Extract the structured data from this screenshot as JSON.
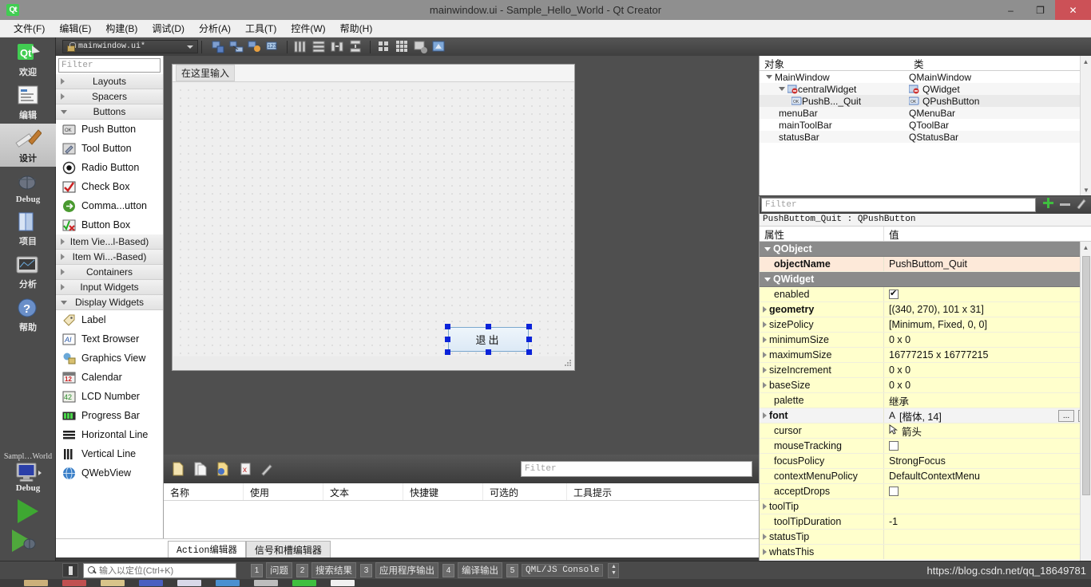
{
  "titlebar": {
    "title": "mainwindow.ui - Sample_Hello_World - Qt Creator",
    "app_icon": "qt-logo-icon",
    "minimize": "–",
    "restore": "❐",
    "close": "✕"
  },
  "menubar": {
    "items": [
      {
        "label": "文件(F)"
      },
      {
        "label": "编辑(E)"
      },
      {
        "label": "构建(B)"
      },
      {
        "label": "调试(D)"
      },
      {
        "label": "分析(A)"
      },
      {
        "label": "工具(T)"
      },
      {
        "label": "控件(W)"
      },
      {
        "label": "帮助(H)"
      }
    ]
  },
  "designer_toolbar": {
    "file_combo": {
      "value": "mainwindow.ui*",
      "icon": "lock-icon",
      "dropdown": "chevron-down-icon"
    },
    "tools": [
      {
        "name": "edit-widgets-icon"
      },
      {
        "name": "edit-signals-slots-icon"
      },
      {
        "name": "edit-buddies-icon"
      },
      {
        "name": "edit-tab-order-icon"
      },
      {
        "name": "layout-horizontally-icon"
      },
      {
        "name": "layout-vertically-icon"
      },
      {
        "name": "layout-splitter-horizontal-icon"
      },
      {
        "name": "layout-splitter-vertical-icon"
      },
      {
        "name": "layout-form-icon"
      },
      {
        "name": "layout-grid-icon"
      },
      {
        "name": "break-layout-icon"
      },
      {
        "name": "adjust-size-icon"
      }
    ]
  },
  "modebar": {
    "modes": [
      {
        "label": "欢迎",
        "icon": "qt-welcome-icon",
        "active": false
      },
      {
        "label": "编辑",
        "icon": "edit-mode-icon",
        "active": false
      },
      {
        "label": "设计",
        "icon": "design-mode-icon",
        "active": true
      },
      {
        "label": "Debug",
        "icon": "debug-bug-icon",
        "active": false
      },
      {
        "label": "项目",
        "icon": "projects-books-icon",
        "active": false
      },
      {
        "label": "分析",
        "icon": "analyze-scope-icon",
        "active": false
      },
      {
        "label": "帮助",
        "icon": "help-question-icon",
        "active": false
      }
    ],
    "run_section": {
      "project_label": "Sampl…World",
      "kit_icon": "computer-kit-icon",
      "kit_label": "Debug",
      "run_button": "run-icon",
      "debug_button": "start-debugging-icon",
      "build_button": "build-hammer-icon"
    }
  },
  "widget_box": {
    "filter_placeholder": "Filter",
    "groups": [
      {
        "label": "Layouts",
        "expanded": false,
        "items": []
      },
      {
        "label": "Spacers",
        "expanded": false,
        "items": []
      },
      {
        "label": "Buttons",
        "expanded": true,
        "items": [
          {
            "label": "Push Button",
            "icon": "push-button-icon"
          },
          {
            "label": "Tool Button",
            "icon": "tool-button-icon"
          },
          {
            "label": "Radio Button",
            "icon": "radio-button-icon"
          },
          {
            "label": "Check Box",
            "icon": "check-box-icon"
          },
          {
            "label": "Comma...utton",
            "icon": "command-link-button-icon"
          },
          {
            "label": "Button Box",
            "icon": "button-box-icon"
          }
        ]
      },
      {
        "label": "Item Vie...l-Based)",
        "expanded": false,
        "items": []
      },
      {
        "label": "Item Wi...-Based)",
        "expanded": false,
        "items": []
      },
      {
        "label": "Containers",
        "expanded": false,
        "items": []
      },
      {
        "label": "Input Widgets",
        "expanded": false,
        "items": []
      },
      {
        "label": "Display Widgets",
        "expanded": true,
        "items": [
          {
            "label": "Label",
            "icon": "label-icon"
          },
          {
            "label": "Text Browser",
            "icon": "text-browser-icon"
          },
          {
            "label": "Graphics View",
            "icon": "graphics-view-icon"
          },
          {
            "label": "Calendar",
            "icon": "calendar-icon"
          },
          {
            "label": "LCD Number",
            "icon": "lcd-number-icon"
          },
          {
            "label": "Progress Bar",
            "icon": "progress-bar-icon"
          },
          {
            "label": "Horizontal Line",
            "icon": "horizontal-line-icon"
          },
          {
            "label": "Vertical Line",
            "icon": "vertical-line-icon"
          },
          {
            "label": "QWebView",
            "icon": "qwebview-icon"
          }
        ]
      }
    ]
  },
  "form_editor": {
    "menu_placeholder": "在这里输入",
    "selected_widget": {
      "text": "退出",
      "handles": 8
    }
  },
  "action_editor": {
    "toolbar_icons": [
      {
        "name": "new-action-icon"
      },
      {
        "name": "copy-action-icon"
      },
      {
        "name": "paste-action-icon"
      },
      {
        "name": "delete-action-icon"
      },
      {
        "name": "configure-icon"
      }
    ],
    "filter_placeholder": "Filter",
    "columns": [
      "名称",
      "使用",
      "文本",
      "快捷键",
      "可选的",
      "工具提示"
    ],
    "rows": []
  },
  "bottom_tabs": [
    {
      "label": "Action编辑器",
      "active": true
    },
    {
      "label": "信号和槽编辑器",
      "active": false
    }
  ],
  "object_inspector": {
    "columns": [
      "对象",
      "类"
    ],
    "rows": [
      {
        "name": "MainWindow",
        "cls": "QMainWindow",
        "indent": 0,
        "expander": "collapse-arrow",
        "icon": "",
        "selected": false
      },
      {
        "name": "centralWidget",
        "cls": "QWidget",
        "indent": 1,
        "expander": "collapse-arrow",
        "icon": "central-widget-icon",
        "selected": false
      },
      {
        "name": "PushB..._Quit",
        "cls": "QPushButton",
        "indent": 2,
        "expander": "",
        "icon": "push-button-icon",
        "selected": true
      },
      {
        "name": "menuBar",
        "cls": "QMenuBar",
        "indent": 1,
        "expander": "",
        "icon": "",
        "selected": false
      },
      {
        "name": "mainToolBar",
        "cls": "QToolBar",
        "indent": 1,
        "expander": "",
        "icon": "",
        "selected": false
      },
      {
        "name": "statusBar",
        "cls": "QStatusBar",
        "indent": 1,
        "expander": "",
        "icon": "",
        "selected": false
      }
    ]
  },
  "property_editor": {
    "filter_placeholder": "Filter",
    "actions": [
      {
        "name": "add-property-icon"
      },
      {
        "name": "remove-property-icon"
      },
      {
        "name": "configure-property-icon"
      }
    ],
    "object_header": "PushButtom_Quit : QPushButton",
    "columns": [
      "属性",
      "值"
    ],
    "rows": [
      {
        "key": "QObject",
        "value": "",
        "kind": "group"
      },
      {
        "key": "objectName",
        "value": "PushButtom_Quit",
        "kind": "highlight",
        "bold": true
      },
      {
        "key": "QWidget",
        "value": "",
        "kind": "group"
      },
      {
        "key": "enabled",
        "value": "",
        "kind": "yellow",
        "widget": "checkbox-on"
      },
      {
        "key": "geometry",
        "value": "[(340, 270), 101 x 31]",
        "kind": "yellow",
        "bold": true,
        "expander": true
      },
      {
        "key": "sizePolicy",
        "value": "[Minimum, Fixed, 0, 0]",
        "kind": "yellow",
        "expander": true
      },
      {
        "key": "minimumSize",
        "value": "0 x 0",
        "kind": "yellow",
        "expander": true
      },
      {
        "key": "maximumSize",
        "value": "16777215 x 16777215",
        "kind": "yellow",
        "expander": true
      },
      {
        "key": "sizeIncrement",
        "value": "0 x 0",
        "kind": "yellow",
        "expander": true
      },
      {
        "key": "baseSize",
        "value": "0 x 0",
        "kind": "yellow",
        "expander": true
      },
      {
        "key": "palette",
        "value": "继承",
        "kind": "yellow"
      },
      {
        "key": "font",
        "value": "[楷体, 14]",
        "kind": "white",
        "bold": true,
        "expander": true,
        "widget": "font-editor",
        "prefix": "A"
      },
      {
        "key": "cursor",
        "value": "箭头",
        "kind": "yellow",
        "widget": "cursor-arrow"
      },
      {
        "key": "mouseTracking",
        "value": "",
        "kind": "yellow",
        "widget": "checkbox-off"
      },
      {
        "key": "focusPolicy",
        "value": "StrongFocus",
        "kind": "yellow"
      },
      {
        "key": "contextMenuPolicy",
        "value": "DefaultContextMenu",
        "kind": "yellow"
      },
      {
        "key": "acceptDrops",
        "value": "",
        "kind": "yellow",
        "widget": "checkbox-off"
      },
      {
        "key": "toolTip",
        "value": "",
        "kind": "yellow",
        "expander": true
      },
      {
        "key": "toolTipDuration",
        "value": "-1",
        "kind": "yellow"
      },
      {
        "key": "statusTip",
        "value": "",
        "kind": "yellow",
        "expander": true
      },
      {
        "key": "whatsThis",
        "value": "",
        "kind": "yellow",
        "expander": true
      }
    ]
  },
  "statusbar": {
    "toggle_sidebar_icon": "toggle-sidebar-icon",
    "locator": {
      "icon": "search-icon",
      "placeholder": "输入以定位(Ctrl+K)"
    },
    "output_panes": [
      {
        "num": "1",
        "label": "问题",
        "mono": false
      },
      {
        "num": "2",
        "label": "搜索结果",
        "mono": false
      },
      {
        "num": "3",
        "label": "应用程序输出",
        "mono": false
      },
      {
        "num": "4",
        "label": "编译输出",
        "mono": false
      },
      {
        "num": "5",
        "label": "QML/JS Console",
        "mono": true
      }
    ],
    "updown_icon": "updown-arrows-icon"
  },
  "watermark": "https://blog.csdn.net/qq_18649781",
  "colors": {
    "titlebar_bg": "#8f8f8f",
    "close_red": "#cc5157",
    "accent_blue": "#0b23d9",
    "property_yellow": "#ffffcc",
    "property_highlight": "#fde9d9",
    "group_gray": "#8b8b8b",
    "qt_green": "#41cd52"
  }
}
